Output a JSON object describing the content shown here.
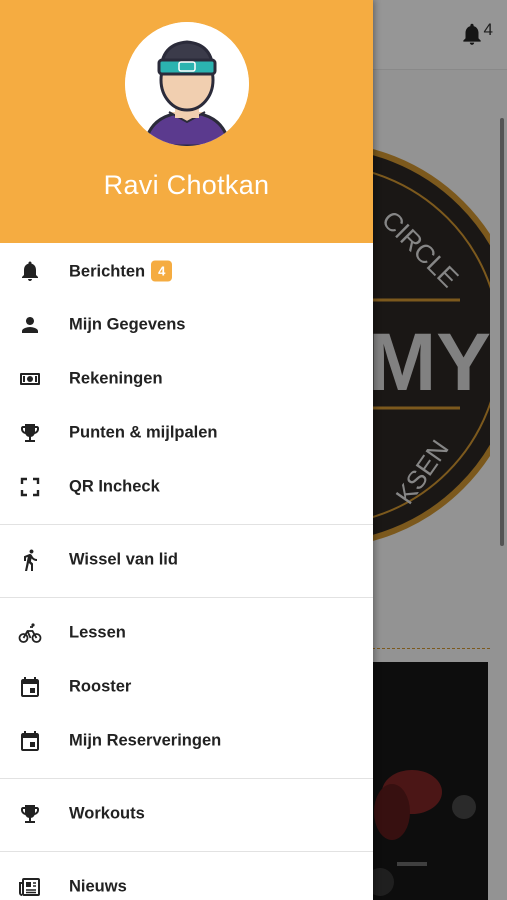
{
  "topbar": {
    "notification_count": "4"
  },
  "background": {
    "logo_text_top": "CIRCLE",
    "logo_text_mid": "MY",
    "logo_text_bottom": "KSEN"
  },
  "drawer": {
    "user_name": "Ravi Chotkan",
    "groups": [
      [
        {
          "label": "Berichten",
          "badge": "4",
          "icon": "bell-icon"
        },
        {
          "label": "Mijn Gegevens",
          "icon": "person-icon"
        },
        {
          "label": "Rekeningen",
          "icon": "cash-icon"
        },
        {
          "label": "Punten & mijlpalen",
          "icon": "trophy-icon"
        },
        {
          "label": "QR Incheck",
          "icon": "qr-scan-icon"
        }
      ],
      [
        {
          "label": "Wissel van lid",
          "icon": "walking-person-icon"
        }
      ],
      [
        {
          "label": "Lessen",
          "icon": "bicycle-icon"
        },
        {
          "label": "Rooster",
          "icon": "calendar-icon"
        },
        {
          "label": "Mijn Reserveringen",
          "icon": "calendar-icon"
        }
      ],
      [
        {
          "label": "Workouts",
          "icon": "trophy-icon"
        }
      ],
      [
        {
          "label": "Nieuws",
          "icon": "newspaper-icon"
        }
      ]
    ]
  },
  "colors": {
    "accent": "#f5ac41",
    "text": "#222222",
    "logo_ring": "#c8902f"
  }
}
